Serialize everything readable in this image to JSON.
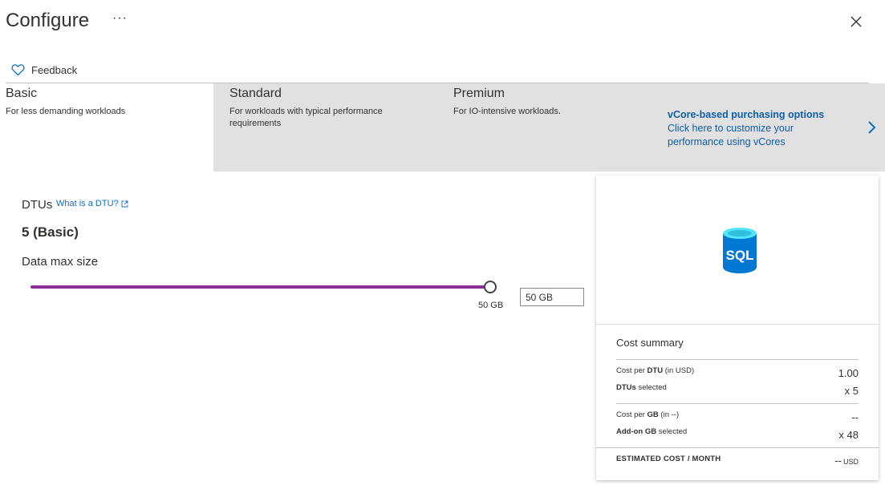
{
  "header": {
    "title": "Configure",
    "more_label": "···",
    "feedback_label": "Feedback"
  },
  "tabs": [
    {
      "name": "Basic",
      "description": "For less demanding workloads"
    },
    {
      "name": "Standard",
      "description": "For workloads with typical performance requirements"
    },
    {
      "name": "Premium",
      "description": "For IO-intensive workloads."
    }
  ],
  "vcore": {
    "title": "vCore-based purchasing options",
    "description": "Click here to customize your performance using vCores"
  },
  "dtu": {
    "label": "DTUs",
    "help_link": "What is a DTU?",
    "value": "5 (Basic)"
  },
  "storage": {
    "label": "Data max size",
    "slider_value_label": "50 GB",
    "slider_fraction": 1.0,
    "input_value": "50 GB"
  },
  "cost_summary": {
    "title": "Cost summary",
    "icon_text": "SQL",
    "rows": [
      {
        "label_bold": "DTU",
        "label_pre": "Cost per ",
        "label_post": " (in USD)",
        "value": "1.00"
      },
      {
        "label_bold": "DTUs",
        "label_pre": "",
        "label_post": " selected",
        "value": "x 5"
      },
      {
        "label_bold": "GB",
        "label_pre": "Cost per ",
        "label_post": " (in --)",
        "value": "--"
      },
      {
        "label_bold": "Add-on GB",
        "label_pre": "",
        "label_post": " selected",
        "value": "x 48"
      }
    ],
    "estimated_label": "ESTIMATED COST / MONTH",
    "estimated_value": "--",
    "estimated_unit": "USD"
  },
  "colors": {
    "accent": "#8a2d96",
    "link": "#0f6cbd",
    "tab_inactive_bg": "#e1e1e1",
    "sql_icon_blue": "#0078d4",
    "sql_icon_cyan": "#50e6ff"
  }
}
